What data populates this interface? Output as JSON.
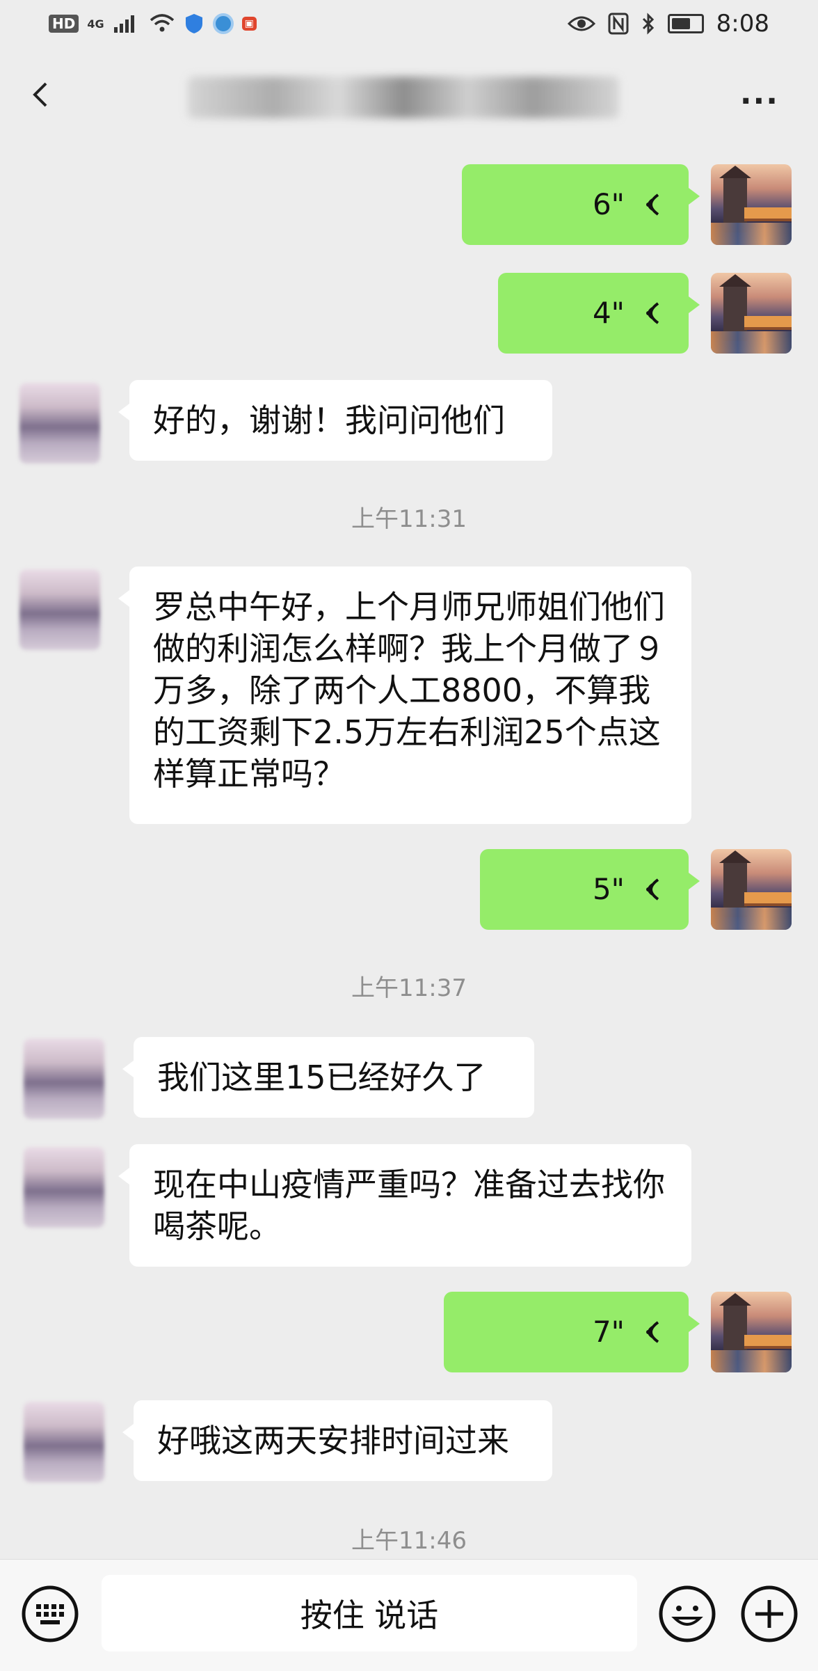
{
  "status_bar": {
    "left_labels": [
      "HD",
      "4G"
    ],
    "time": "8:08",
    "app_badge": "",
    "icons": [
      "signal-icon",
      "wifi-icon",
      "shield-icon",
      "app-icon",
      "eye-icon",
      "nfc-icon",
      "bluetooth-icon",
      "battery-icon"
    ]
  },
  "header": {
    "title": "",
    "more_label": "···"
  },
  "messages": [
    {
      "side": "out",
      "type": "voice",
      "duration": "6\""
    },
    {
      "side": "out",
      "type": "voice",
      "duration": "4\""
    },
    {
      "side": "in",
      "type": "text",
      "text": "好的，谢谢！我问问他们"
    },
    {
      "type": "time",
      "text": "上午11:31"
    },
    {
      "side": "in",
      "type": "text",
      "text": "罗总中午好，上个月师兄师姐们他们做的利润怎么样啊？我上个月做了９万多，除了两个人工8800，不算我的工资剩下2.5万左右利润25个点这样算正常吗？"
    },
    {
      "side": "out",
      "type": "voice",
      "duration": "5\""
    },
    {
      "type": "time",
      "text": "上午11:37"
    },
    {
      "side": "in",
      "type": "text",
      "text": "我们这里15已经好久了"
    },
    {
      "side": "in",
      "type": "text",
      "text": "现在中山疫情严重吗？准备过去找你喝茶呢。"
    },
    {
      "side": "out",
      "type": "voice",
      "duration": "7\""
    },
    {
      "side": "in",
      "type": "text",
      "text": "好哦这两天安排时间过来"
    },
    {
      "type": "time",
      "text": "上午11:46"
    }
  ],
  "input_bar": {
    "talk_label": "按住 说话"
  },
  "colors": {
    "background": "#ededed",
    "outgoing_bubble": "#95ec69",
    "incoming_bubble": "#ffffff",
    "timestamp": "#8e8e8e"
  }
}
